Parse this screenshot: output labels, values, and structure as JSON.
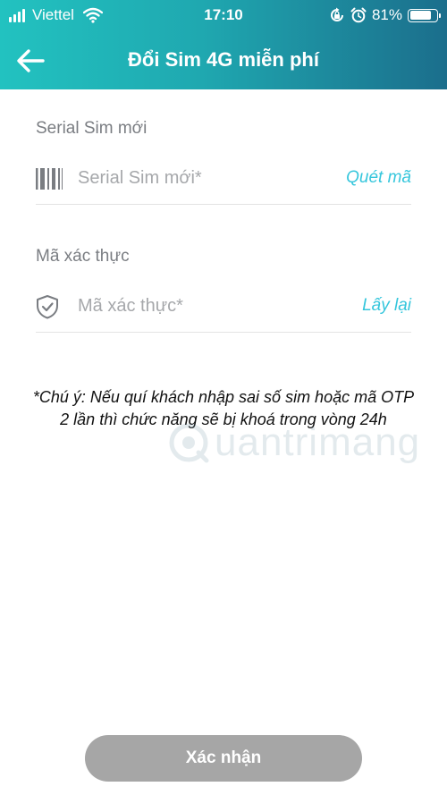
{
  "status_bar": {
    "carrier": "Viettel",
    "time": "17:10",
    "battery_percent": "81%",
    "battery_level": 0.81,
    "icons": [
      "signal-icon",
      "wifi-icon",
      "rotation-lock-icon",
      "alarm-icon",
      "battery-icon"
    ]
  },
  "header": {
    "title": "Đổi Sim 4G miễn phí",
    "back_icon": "arrow-left-icon"
  },
  "form": {
    "serial": {
      "label": "Serial Sim mới",
      "placeholder": "Serial Sim mới*",
      "value": "",
      "icon": "barcode-icon",
      "action_label": "Quét mã"
    },
    "otp": {
      "label": "Mã xác thực",
      "placeholder": "Mã xác thực*",
      "value": "",
      "icon": "shield-check-icon",
      "action_label": "Lấy lại"
    }
  },
  "note": {
    "line1": "*Chú ý: Nếu quí khách nhập sai số sim hoặc mã OTP",
    "line2": "2 lần thì chức năng sẽ bị khoá trong vòng 24h"
  },
  "watermark": {
    "text": "uantrimang",
    "icon": "quantrimang-logo-icon"
  },
  "confirm_button": {
    "label": "Xác nhận",
    "color": "#a6a6a6"
  },
  "colors": {
    "header_gradient_start": "#22c2c0",
    "header_gradient_end": "#1b6e8c",
    "accent": "#35c6dc",
    "label_gray": "#7a7d82"
  }
}
